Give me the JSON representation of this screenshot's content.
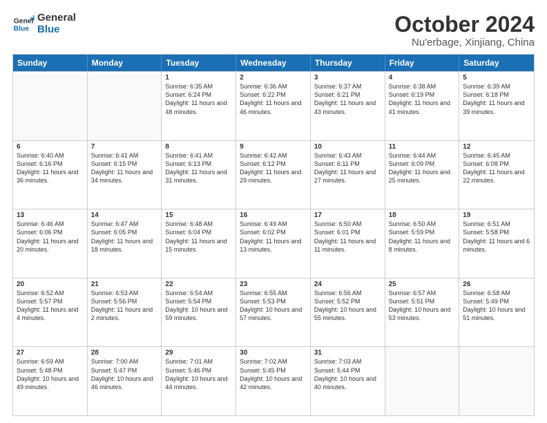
{
  "logo": {
    "line1": "General",
    "line2": "Blue"
  },
  "title": {
    "month": "October 2024",
    "location": "Nu'erbage, Xinjiang, China"
  },
  "weekdays": [
    "Sunday",
    "Monday",
    "Tuesday",
    "Wednesday",
    "Thursday",
    "Friday",
    "Saturday"
  ],
  "rows": [
    [
      {
        "day": "",
        "text": ""
      },
      {
        "day": "",
        "text": ""
      },
      {
        "day": "1",
        "text": "Sunrise: 6:35 AM\nSunset: 6:24 PM\nDaylight: 11 hours and 48 minutes."
      },
      {
        "day": "2",
        "text": "Sunrise: 6:36 AM\nSunset: 6:22 PM\nDaylight: 11 hours and 46 minutes."
      },
      {
        "day": "3",
        "text": "Sunrise: 6:37 AM\nSunset: 6:21 PM\nDaylight: 11 hours and 43 minutes."
      },
      {
        "day": "4",
        "text": "Sunrise: 6:38 AM\nSunset: 6:19 PM\nDaylight: 11 hours and 41 minutes."
      },
      {
        "day": "5",
        "text": "Sunrise: 6:39 AM\nSunset: 6:18 PM\nDaylight: 11 hours and 39 minutes."
      }
    ],
    [
      {
        "day": "6",
        "text": "Sunrise: 6:40 AM\nSunset: 6:16 PM\nDaylight: 11 hours and 36 minutes."
      },
      {
        "day": "7",
        "text": "Sunrise: 6:41 AM\nSunset: 6:15 PM\nDaylight: 11 hours and 34 minutes."
      },
      {
        "day": "8",
        "text": "Sunrise: 6:41 AM\nSunset: 6:13 PM\nDaylight: 11 hours and 31 minutes."
      },
      {
        "day": "9",
        "text": "Sunrise: 6:42 AM\nSunset: 6:12 PM\nDaylight: 11 hours and 29 minutes."
      },
      {
        "day": "10",
        "text": "Sunrise: 6:43 AM\nSunset: 6:11 PM\nDaylight: 11 hours and 27 minutes."
      },
      {
        "day": "11",
        "text": "Sunrise: 6:44 AM\nSunset: 6:09 PM\nDaylight: 11 hours and 25 minutes."
      },
      {
        "day": "12",
        "text": "Sunrise: 6:45 AM\nSunset: 6:08 PM\nDaylight: 11 hours and 22 minutes."
      }
    ],
    [
      {
        "day": "13",
        "text": "Sunrise: 6:46 AM\nSunset: 6:06 PM\nDaylight: 11 hours and 20 minutes."
      },
      {
        "day": "14",
        "text": "Sunrise: 6:47 AM\nSunset: 6:05 PM\nDaylight: 11 hours and 18 minutes."
      },
      {
        "day": "15",
        "text": "Sunrise: 6:48 AM\nSunset: 6:04 PM\nDaylight: 11 hours and 15 minutes."
      },
      {
        "day": "16",
        "text": "Sunrise: 6:49 AM\nSunset: 6:02 PM\nDaylight: 11 hours and 13 minutes."
      },
      {
        "day": "17",
        "text": "Sunrise: 6:50 AM\nSunset: 6:01 PM\nDaylight: 11 hours and 11 minutes."
      },
      {
        "day": "18",
        "text": "Sunrise: 6:50 AM\nSunset: 5:59 PM\nDaylight: 11 hours and 8 minutes."
      },
      {
        "day": "19",
        "text": "Sunrise: 6:51 AM\nSunset: 5:58 PM\nDaylight: 11 hours and 6 minutes."
      }
    ],
    [
      {
        "day": "20",
        "text": "Sunrise: 6:52 AM\nSunset: 5:57 PM\nDaylight: 11 hours and 4 minutes."
      },
      {
        "day": "21",
        "text": "Sunrise: 6:53 AM\nSunset: 5:56 PM\nDaylight: 11 hours and 2 minutes."
      },
      {
        "day": "22",
        "text": "Sunrise: 6:54 AM\nSunset: 5:54 PM\nDaylight: 10 hours and 59 minutes."
      },
      {
        "day": "23",
        "text": "Sunrise: 6:55 AM\nSunset: 5:53 PM\nDaylight: 10 hours and 57 minutes."
      },
      {
        "day": "24",
        "text": "Sunrise: 6:56 AM\nSunset: 5:52 PM\nDaylight: 10 hours and 55 minutes."
      },
      {
        "day": "25",
        "text": "Sunrise: 6:57 AM\nSunset: 5:51 PM\nDaylight: 10 hours and 53 minutes."
      },
      {
        "day": "26",
        "text": "Sunrise: 6:58 AM\nSunset: 5:49 PM\nDaylight: 10 hours and 51 minutes."
      }
    ],
    [
      {
        "day": "27",
        "text": "Sunrise: 6:59 AM\nSunset: 5:48 PM\nDaylight: 10 hours and 49 minutes."
      },
      {
        "day": "28",
        "text": "Sunrise: 7:00 AM\nSunset: 5:47 PM\nDaylight: 10 hours and 46 minutes."
      },
      {
        "day": "29",
        "text": "Sunrise: 7:01 AM\nSunset: 5:46 PM\nDaylight: 10 hours and 44 minutes."
      },
      {
        "day": "30",
        "text": "Sunrise: 7:02 AM\nSunset: 5:45 PM\nDaylight: 10 hours and 42 minutes."
      },
      {
        "day": "31",
        "text": "Sunrise: 7:03 AM\nSunset: 5:44 PM\nDaylight: 10 hours and 40 minutes."
      },
      {
        "day": "",
        "text": ""
      },
      {
        "day": "",
        "text": ""
      }
    ]
  ]
}
